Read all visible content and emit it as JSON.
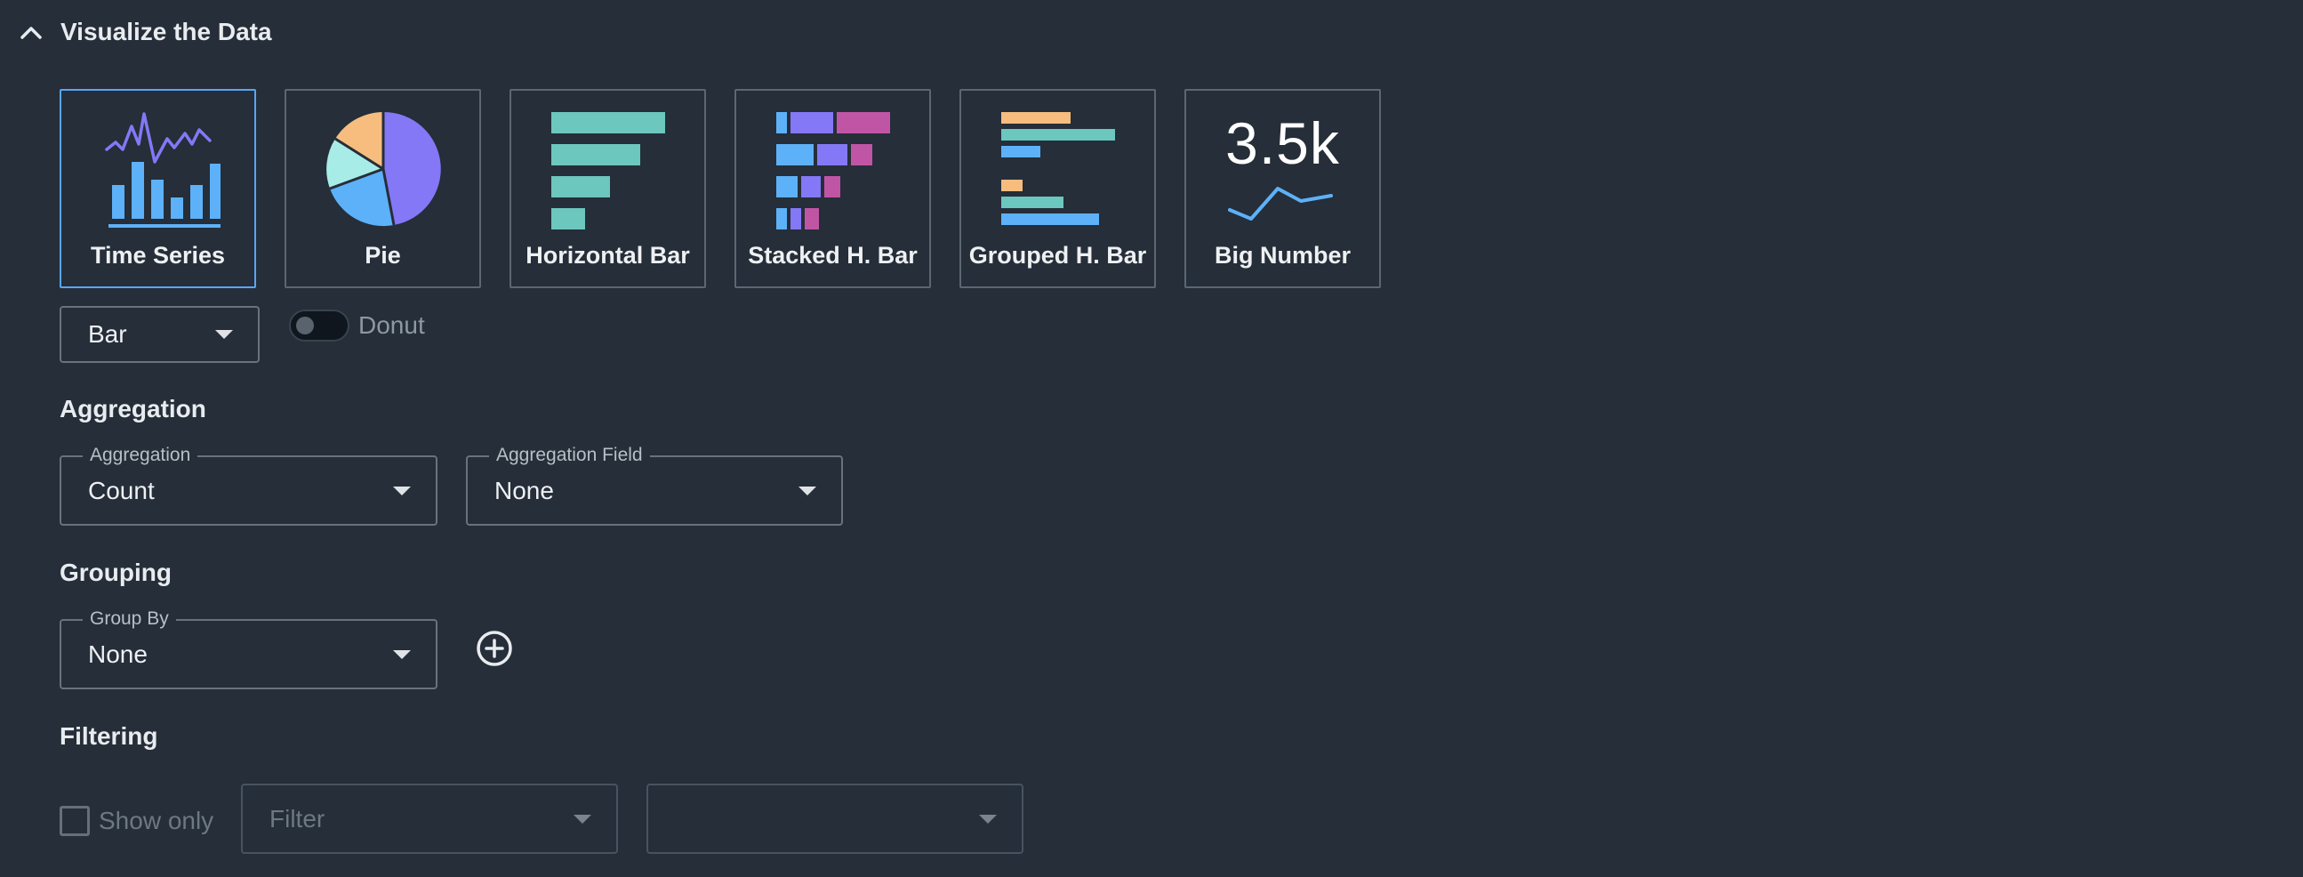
{
  "section": {
    "title": "Visualize the Data"
  },
  "viz_types": [
    {
      "label": "Time Series",
      "selected": true
    },
    {
      "label": "Pie",
      "selected": false
    },
    {
      "label": "Horizontal Bar",
      "selected": false
    },
    {
      "label": "Stacked H. Bar",
      "selected": false
    },
    {
      "label": "Grouped H. Bar",
      "selected": false
    },
    {
      "label": "Big Number",
      "selected": false,
      "preview_value": "3.5k"
    }
  ],
  "chart_style": {
    "value": "Bar"
  },
  "donut": {
    "label": "Donut",
    "enabled": false
  },
  "aggregation": {
    "heading": "Aggregation",
    "aggregation_label": "Aggregation",
    "aggregation_value": "Count",
    "field_label": "Aggregation Field",
    "field_value": "None"
  },
  "grouping": {
    "heading": "Grouping",
    "group_by_label": "Group By",
    "group_by_value": "None"
  },
  "filtering": {
    "heading": "Filtering",
    "show_only_label": "Show only",
    "show_only_checked": false,
    "filter_placeholder": "Filter",
    "value_placeholder": ""
  },
  "colors": {
    "background": "#252e39",
    "selected_border": "#5aa5f5",
    "bar_blue": "#5db1f8",
    "teal": "#6cc7be",
    "purple": "#8478f6",
    "magenta": "#c155a5",
    "orange": "#f6bd7e",
    "light_teal": "#a8ece8"
  }
}
